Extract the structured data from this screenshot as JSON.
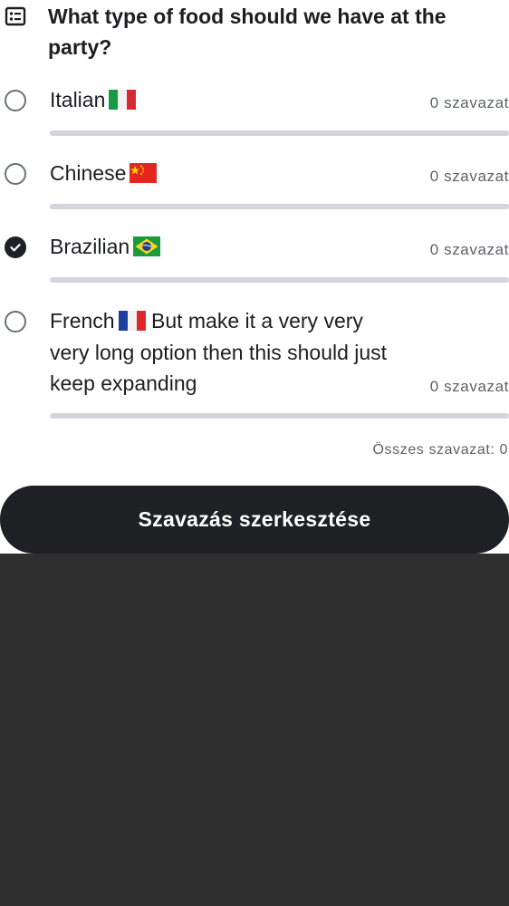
{
  "poll": {
    "question": "What type of food should we have at the party?",
    "icon": "poll-list-icon",
    "options": [
      {
        "label": "Italian",
        "flag": "italy-flag-icon",
        "votes_text": "0 szavazat",
        "votes": 0,
        "selected": false
      },
      {
        "label": "Chinese",
        "flag": "china-flag-icon",
        "votes_text": "0 szavazat",
        "votes": 0,
        "selected": false
      },
      {
        "label": "Brazilian",
        "flag": "brazil-flag-icon",
        "votes_text": "0 szavazat",
        "votes": 0,
        "selected": true
      },
      {
        "label_before_flag": "French",
        "label_after_flag": " But make it a very very very long option then this should just keep expanding",
        "flag": "france-flag-icon",
        "votes_text": "0 szavazat",
        "votes": 0,
        "selected": false
      }
    ],
    "total_votes": "Összes szavazat: 0",
    "edit_button_label": "Szavazás szerkesztése"
  },
  "colors": {
    "text": "#1d1e22",
    "muted": "#5d6169",
    "track": "#d2d5dc",
    "button_bg": "#1f2024",
    "background_below": "#2f2f2f"
  }
}
